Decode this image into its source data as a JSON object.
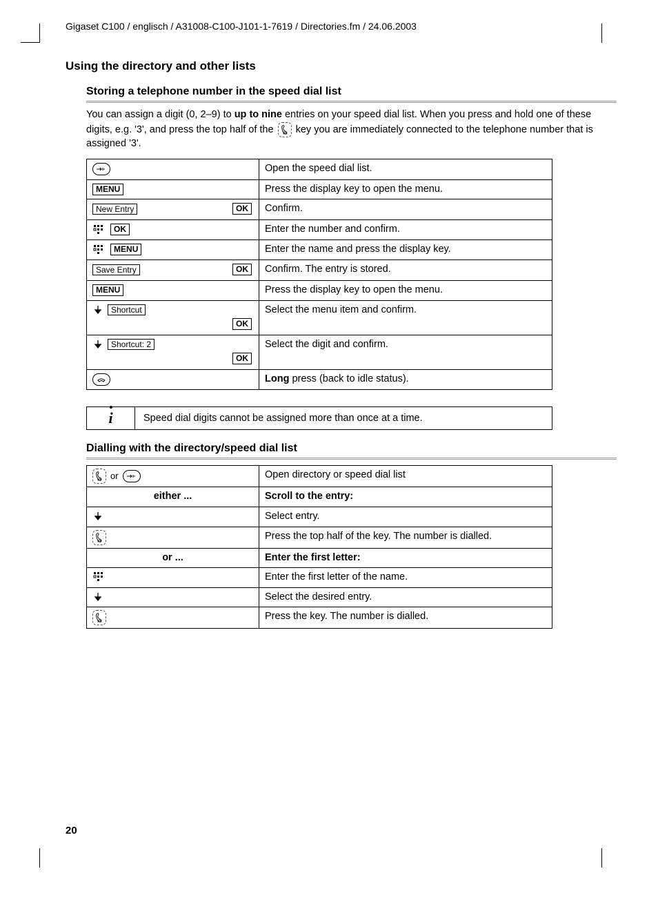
{
  "header": "Gigaset C100 / englisch / A31008-C100-J101-1-7619 / Directories.fm / 24.06.2003",
  "section_title": "Using the directory and other lists",
  "sub1_title": "Storing a telephone number in the speed dial list",
  "intro_pre": "You can assign a digit (0, 2–9) to ",
  "intro_bold": "up to nine",
  "intro_post1": " entries on your speed dial list. When you press and hold one of these digits, e.g. '3', and press the top half of the ",
  "intro_post2": " key you are immediately connected to the telephone number that is assigned '3'.",
  "keys": {
    "menu": "MENU",
    "ok": "OK",
    "new_entry": "New Entry",
    "save_entry": "Save Entry",
    "shortcut": "Shortcut",
    "shortcut2": "Shortcut: 2",
    "or": "or"
  },
  "table1": {
    "r1": "Open the speed dial list.",
    "r2": "Press the display key to open the menu.",
    "r3": "Confirm.",
    "r4": "Enter the number and confirm.",
    "r5": "Enter the name and press the display key.",
    "r6": "Confirm. The entry is stored.",
    "r7": "Press the display key to open the menu.",
    "r8": "Select the menu item and confirm.",
    "r9": "Select the digit and confirm.",
    "r10_bold": "Long",
    "r10_rest": " press (back to idle status)."
  },
  "note_text": "Speed dial digits cannot be assigned more than once at a time.",
  "sub2_title": "Dialling with the directory/speed dial list",
  "table2": {
    "r1": "Open directory or speed dial list",
    "either": "either ...",
    "scroll": "Scroll to the entry:",
    "r3": "Select entry.",
    "r4": "Press the top half of the key. The number is dialled.",
    "or": "or ...",
    "enter_letter": "Enter the first letter:",
    "r6": "Enter the first letter of the name.",
    "r7": "Select the desired entry.",
    "r8": "Press the key. The number is dialled."
  },
  "page_number": "20"
}
